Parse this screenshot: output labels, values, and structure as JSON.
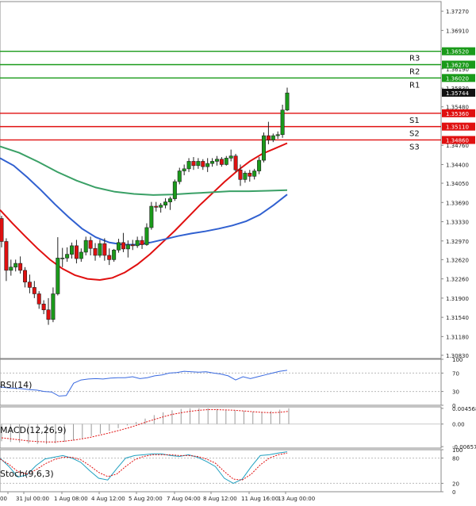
{
  "chart_data": {
    "type": "candlestick",
    "price_axis": {
      "ticks": [
        "1.37270",
        "1.36910",
        "1.36550",
        "1.36190",
        "1.35830",
        "1.35480",
        "1.34760",
        "1.34400",
        "1.34050",
        "1.33690",
        "1.33330",
        "1.32970",
        "1.32620",
        "1.32260",
        "1.31900",
        "1.31540",
        "1.31180",
        "1.30830"
      ],
      "range": [
        1.3077,
        1.3745
      ]
    },
    "levels": [
      {
        "name": "R3",
        "value": 1.3652,
        "label": "1.36520",
        "color": "#1a9a1a"
      },
      {
        "name": "R2",
        "value": 1.3627,
        "label": "1.36270",
        "color": "#1a9a1a"
      },
      {
        "name": "R1",
        "value": 1.3602,
        "label": "1.36020",
        "color": "#1a9a1a"
      },
      {
        "name": "S1",
        "value": 1.3536,
        "label": "1.35360",
        "color": "#e01010"
      },
      {
        "name": "S2",
        "value": 1.3511,
        "label": "1.35110",
        "color": "#e01010"
      },
      {
        "name": "S3",
        "value": 1.3486,
        "label": "1.34860",
        "color": "#e01010"
      }
    ],
    "last_price": {
      "value": 1.35744,
      "label": "1.35744"
    },
    "x_axis_labels": [
      "00",
      "31 Jul 00:00",
      "1 Aug 08:00",
      "4 Aug 12:00",
      "5 Aug 20:00",
      "7 Aug 04:00",
      "8 Aug 12:00",
      "11 Aug 16:00",
      "13 Aug 00:00"
    ],
    "candles": [
      [
        1.3339,
        1.3344,
        1.3285,
        1.3296
      ],
      [
        1.3296,
        1.3302,
        1.3222,
        1.3242
      ],
      [
        1.3242,
        1.3262,
        1.3232,
        1.3248
      ],
      [
        1.3248,
        1.3262,
        1.324,
        1.3255
      ],
      [
        1.3255,
        1.3268,
        1.3236,
        1.3242
      ],
      [
        1.3242,
        1.3248,
        1.321,
        1.322
      ],
      [
        1.322,
        1.3234,
        1.3199,
        1.321
      ],
      [
        1.321,
        1.3222,
        1.319,
        1.3198
      ],
      [
        1.3198,
        1.3203,
        1.317,
        1.3179
      ],
      [
        1.3179,
        1.3186,
        1.316,
        1.3168
      ],
      [
        1.3168,
        1.319,
        1.314,
        1.315
      ],
      [
        1.315,
        1.321,
        1.3145,
        1.3198
      ],
      [
        1.3198,
        1.3304,
        1.3195,
        1.3265
      ],
      [
        1.3265,
        1.3284,
        1.3248,
        1.3265
      ],
      [
        1.3265,
        1.3285,
        1.3258,
        1.3272
      ],
      [
        1.3272,
        1.3294,
        1.3264,
        1.3288
      ],
      [
        1.3288,
        1.3299,
        1.3255,
        1.3264
      ],
      [
        1.3264,
        1.3283,
        1.3258,
        1.3276
      ],
      [
        1.3276,
        1.3305,
        1.327,
        1.3298
      ],
      [
        1.3298,
        1.3305,
        1.327,
        1.3283
      ],
      [
        1.3283,
        1.3293,
        1.326,
        1.327
      ],
      [
        1.327,
        1.3299,
        1.3266,
        1.3292
      ],
      [
        1.3292,
        1.3302,
        1.326,
        1.327
      ],
      [
        1.327,
        1.3283,
        1.3252,
        1.3262
      ],
      [
        1.3262,
        1.3282,
        1.3258,
        1.328
      ],
      [
        1.328,
        1.3301,
        1.3275,
        1.3294
      ],
      [
        1.3294,
        1.3312,
        1.3276,
        1.3282
      ],
      [
        1.3282,
        1.3298,
        1.3266,
        1.329
      ],
      [
        1.329,
        1.3299,
        1.328,
        1.3288
      ],
      [
        1.3288,
        1.3305,
        1.3284,
        1.3298
      ],
      [
        1.3298,
        1.3306,
        1.3282,
        1.329
      ],
      [
        1.329,
        1.333,
        1.3288,
        1.3322
      ],
      [
        1.3322,
        1.337,
        1.3318,
        1.3362
      ],
      [
        1.3362,
        1.337,
        1.3352,
        1.336
      ],
      [
        1.336,
        1.3368,
        1.335,
        1.3364
      ],
      [
        1.3364,
        1.3377,
        1.3358,
        1.337
      ],
      [
        1.337,
        1.338,
        1.3355,
        1.3376
      ],
      [
        1.3376,
        1.3412,
        1.3372,
        1.3408
      ],
      [
        1.3408,
        1.3434,
        1.3403,
        1.3428
      ],
      [
        1.3428,
        1.344,
        1.342,
        1.3432
      ],
      [
        1.3432,
        1.3452,
        1.3426,
        1.3446
      ],
      [
        1.3446,
        1.3454,
        1.343,
        1.3438
      ],
      [
        1.3438,
        1.3452,
        1.3432,
        1.3446
      ],
      [
        1.3446,
        1.345,
        1.343,
        1.3436
      ],
      [
        1.3436,
        1.3452,
        1.3426,
        1.3442
      ],
      [
        1.3442,
        1.3452,
        1.3436,
        1.3446
      ],
      [
        1.3446,
        1.3456,
        1.3438,
        1.345
      ],
      [
        1.345,
        1.3454,
        1.3436,
        1.344
      ],
      [
        1.344,
        1.3456,
        1.3438,
        1.3452
      ],
      [
        1.3452,
        1.3468,
        1.3446,
        1.3456
      ],
      [
        1.3456,
        1.346,
        1.3426,
        1.343
      ],
      [
        1.343,
        1.344,
        1.34,
        1.3412
      ],
      [
        1.3412,
        1.3428,
        1.3406,
        1.3424
      ],
      [
        1.3424,
        1.343,
        1.3408,
        1.3418
      ],
      [
        1.3418,
        1.3432,
        1.3412,
        1.3428
      ],
      [
        1.3428,
        1.3454,
        1.3422,
        1.3448
      ],
      [
        1.3448,
        1.35,
        1.3444,
        1.3494
      ],
      [
        1.3494,
        1.352,
        1.3478,
        1.3486
      ],
      [
        1.3486,
        1.3498,
        1.3482,
        1.3494
      ],
      [
        1.3494,
        1.3502,
        1.3488,
        1.3496
      ],
      [
        1.3496,
        1.3552,
        1.349,
        1.3542
      ],
      [
        1.3542,
        1.3584,
        1.354,
        1.3574
      ]
    ],
    "moving_averages": [
      {
        "color": "#e01010",
        "values": [
          1.3355,
          1.333,
          1.3306,
          1.3283,
          1.3262,
          1.3245,
          1.3233,
          1.3226,
          1.3224,
          1.3228,
          1.3238,
          1.3253,
          1.3272,
          1.3294,
          1.3316,
          1.334,
          1.3364,
          1.3386,
          1.3408,
          1.3428,
          1.3446,
          1.346,
          1.347,
          1.348
        ]
      },
      {
        "color": "#3060d0",
        "values": [
          1.3452,
          1.3438,
          1.3416,
          1.3392,
          1.3366,
          1.3342,
          1.332,
          1.3304,
          1.3294,
          1.329,
          1.329,
          1.3294,
          1.33,
          1.3306,
          1.3311,
          1.3315,
          1.332,
          1.3326,
          1.3334,
          1.3346,
          1.3364,
          1.3384
        ]
      },
      {
        "color": "#3aa066",
        "values": [
          1.3474,
          1.3462,
          1.3445,
          1.3426,
          1.341,
          1.3397,
          1.3389,
          1.3385,
          1.3383,
          1.3384,
          1.3386,
          1.3388,
          1.339,
          1.339,
          1.3391,
          1.3392
        ]
      }
    ],
    "indicators": [
      {
        "name": "RSI(14)",
        "ticks": [
          "100",
          "70",
          "30",
          "0"
        ],
        "range": [
          0,
          100
        ],
        "color": "#3a6ae0",
        "values": [
          40,
          38,
          37,
          36,
          34,
          33,
          30,
          29,
          20,
          21,
          48,
          55,
          57,
          58,
          57,
          59,
          60,
          60,
          62,
          58,
          60,
          64,
          66,
          70,
          71,
          74,
          73,
          72,
          73,
          70,
          68,
          64,
          55,
          62,
          58,
          62,
          66,
          70,
          74,
          76
        ]
      },
      {
        "name": "MACD(12,26,9)",
        "ticks": [
          "0.004568",
          "0.00",
          "-0.006576"
        ],
        "range": [
          -0.007,
          0.005
        ],
        "histogram": [
          -0.005,
          -0.0052,
          -0.0054,
          -0.0056,
          -0.0058,
          -0.0058,
          -0.0056,
          -0.0052,
          -0.0048,
          -0.0042,
          -0.0035,
          -0.0028,
          -0.002,
          -0.0012,
          -0.0004,
          0.0006,
          0.0016,
          0.0026,
          0.0034,
          0.004,
          0.0044,
          0.0046,
          0.0046,
          0.0046,
          0.0044,
          0.0042,
          0.004,
          0.0038,
          0.0036,
          0.0036,
          0.0038,
          0.0042,
          0.0046
        ],
        "signal": [
          -0.004,
          -0.0043,
          -0.0046,
          -0.0049,
          -0.0051,
          -0.0052,
          -0.0052,
          -0.005,
          -0.0047,
          -0.0043,
          -0.0038,
          -0.0032,
          -0.0026,
          -0.0019,
          -0.0012,
          -0.0004,
          0.0005,
          0.0013,
          0.0021,
          0.0028,
          0.0033,
          0.0037,
          0.004,
          0.0042,
          0.0042,
          0.0041,
          0.004,
          0.0038,
          0.0036,
          0.0034,
          0.0033,
          0.0034,
          0.0037
        ],
        "signal_color": "#e01010",
        "histogram_color": "#9a9a9a"
      },
      {
        "name": "Stoch(9,6,3)",
        "ticks": [
          "100",
          "80",
          "20",
          "0"
        ],
        "range": [
          0,
          100
        ],
        "main": [
          80,
          60,
          35,
          40,
          62,
          78,
          82,
          86,
          80,
          70,
          50,
          32,
          28,
          55,
          80,
          86,
          88,
          90,
          90,
          86,
          84,
          88,
          82,
          72,
          60,
          32,
          20,
          30,
          60,
          86,
          88,
          92,
          95
        ],
        "signal": [
          78,
          65,
          48,
          42,
          52,
          66,
          76,
          82,
          82,
          76,
          62,
          46,
          36,
          42,
          60,
          76,
          84,
          88,
          88,
          88,
          86,
          86,
          84,
          78,
          68,
          48,
          30,
          28,
          42,
          64,
          80,
          88,
          92
        ],
        "main_color": "#20a0c0",
        "signal_color": "#e01010"
      }
    ]
  }
}
